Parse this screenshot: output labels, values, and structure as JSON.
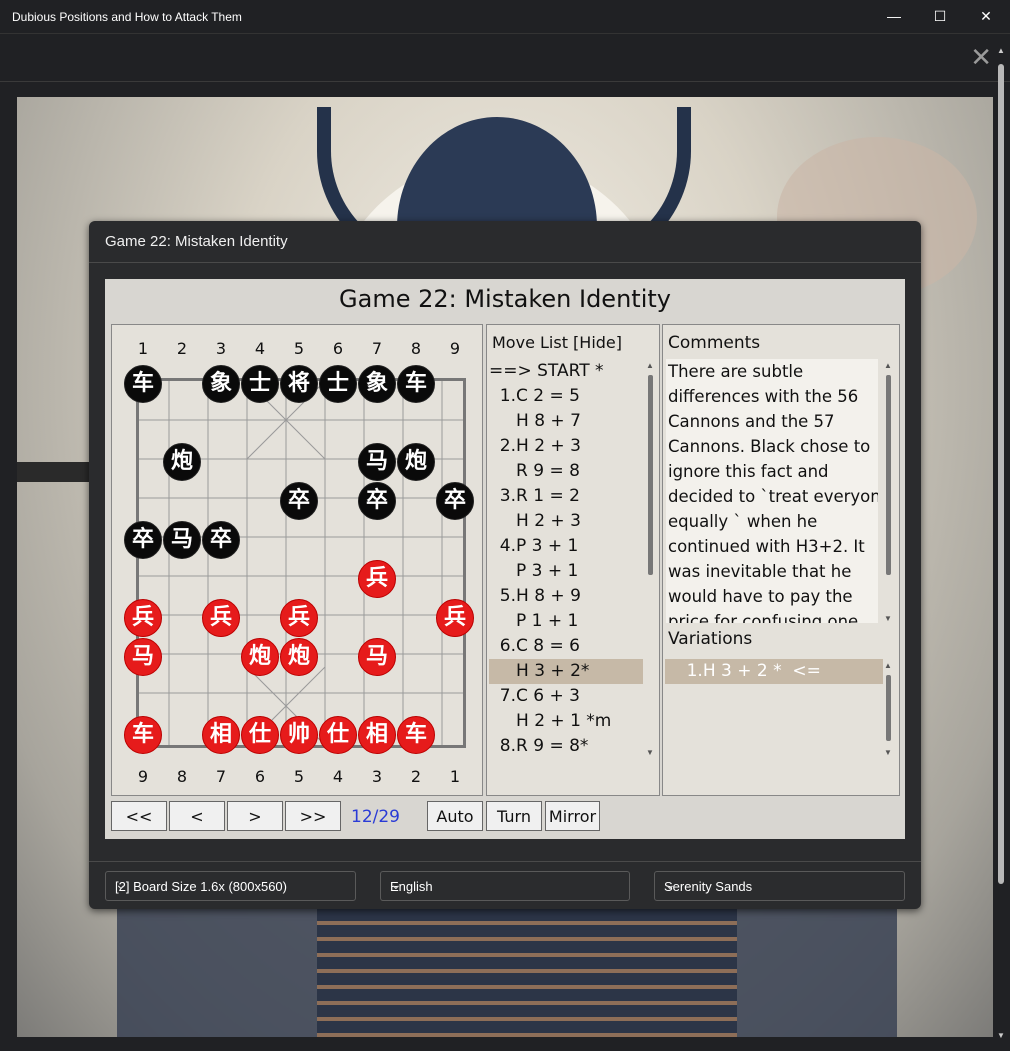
{
  "window": {
    "title": "Dubious Positions and How to Attack Them",
    "minimize": "—",
    "maximize": "☐",
    "close": "✕"
  },
  "toolbar": {
    "close_icon": "✕"
  },
  "dialog": {
    "title": "Game 22: Mistaken Identity",
    "game_title": "Game 22: Mistaken Identity"
  },
  "board": {
    "files_top": [
      "1",
      "2",
      "3",
      "4",
      "5",
      "6",
      "7",
      "8",
      "9"
    ],
    "files_bottom": [
      "9",
      "8",
      "7",
      "6",
      "5",
      "4",
      "3",
      "2",
      "1"
    ],
    "pieces": [
      {
        "char": "车",
        "side": "black",
        "file": 0,
        "rank": 0
      },
      {
        "char": "象",
        "side": "black",
        "file": 2,
        "rank": 0
      },
      {
        "char": "士",
        "side": "black",
        "file": 3,
        "rank": 0
      },
      {
        "char": "将",
        "side": "black",
        "file": 4,
        "rank": 0
      },
      {
        "char": "士",
        "side": "black",
        "file": 5,
        "rank": 0
      },
      {
        "char": "象",
        "side": "black",
        "file": 6,
        "rank": 0
      },
      {
        "char": "车",
        "side": "black",
        "file": 7,
        "rank": 0
      },
      {
        "char": "炮",
        "side": "black",
        "file": 1,
        "rank": 2
      },
      {
        "char": "马",
        "side": "black",
        "file": 6,
        "rank": 2
      },
      {
        "char": "炮",
        "side": "black",
        "file": 7,
        "rank": 2
      },
      {
        "char": "卒",
        "side": "black",
        "file": 4,
        "rank": 3
      },
      {
        "char": "卒",
        "side": "black",
        "file": 6,
        "rank": 3
      },
      {
        "char": "卒",
        "side": "black",
        "file": 8,
        "rank": 3
      },
      {
        "char": "卒",
        "side": "black",
        "file": 0,
        "rank": 4
      },
      {
        "char": "马",
        "side": "black",
        "file": 1,
        "rank": 4
      },
      {
        "char": "卒",
        "side": "black",
        "file": 2,
        "rank": 4
      },
      {
        "char": "兵",
        "side": "red",
        "file": 6,
        "rank": 5
      },
      {
        "char": "兵",
        "side": "red",
        "file": 0,
        "rank": 6
      },
      {
        "char": "兵",
        "side": "red",
        "file": 2,
        "rank": 6
      },
      {
        "char": "兵",
        "side": "red",
        "file": 4,
        "rank": 6
      },
      {
        "char": "兵",
        "side": "red",
        "file": 8,
        "rank": 6
      },
      {
        "char": "马",
        "side": "red",
        "file": 0,
        "rank": 7
      },
      {
        "char": "炮",
        "side": "red",
        "file": 3,
        "rank": 7
      },
      {
        "char": "炮",
        "side": "red",
        "file": 4,
        "rank": 7
      },
      {
        "char": "马",
        "side": "red",
        "file": 6,
        "rank": 7
      },
      {
        "char": "车",
        "side": "red",
        "file": 0,
        "rank": 9
      },
      {
        "char": "相",
        "side": "red",
        "file": 2,
        "rank": 9
      },
      {
        "char": "仕",
        "side": "red",
        "file": 3,
        "rank": 9
      },
      {
        "char": "帅",
        "side": "red",
        "file": 4,
        "rank": 9
      },
      {
        "char": "仕",
        "side": "red",
        "file": 5,
        "rank": 9
      },
      {
        "char": "相",
        "side": "red",
        "file": 6,
        "rank": 9
      },
      {
        "char": "车",
        "side": "red",
        "file": 7,
        "rank": 9
      }
    ]
  },
  "nav": {
    "first": "<<",
    "prev": "<",
    "next": ">",
    "last": ">>",
    "counter": "12/29",
    "auto": "Auto",
    "turn": "Turn",
    "mirror": "Mirror"
  },
  "moves": {
    "header": "Move List [Hide]",
    "rows": [
      "==> START *",
      "  1.C 2 = 5",
      "     H 8 + 7",
      "  2.H 2 + 3",
      "     R 9 = 8",
      "  3.R 1 = 2",
      "     H 2 + 3",
      "  4.P 3 + 1",
      "     P 3 + 1",
      "  5.H 8 + 9",
      "     P 1 + 1",
      "  6.C 8 = 6",
      "     H 3 + 2*",
      "  7.C 6 + 3",
      "     H 2 + 1 *m",
      "  8.R 9 = 8*"
    ],
    "selected_index": 12
  },
  "comments": {
    "header": "Comments",
    "lines": [
      "There are subtle",
      "differences with the 56",
      "Cannons and the 57",
      "Cannons. Black chose to",
      "ignore this fact and",
      "decided to `treat everyone",
      "equally ` when he",
      "continued with H3+2. It",
      "was inevitable that he",
      "would have to pay the",
      "price for confusing one"
    ]
  },
  "variations": {
    "header": "Variations",
    "rows": [
      "    1.H 3 + 2 *  <="
    ]
  },
  "footer": {
    "board_size": "[2] Board Size 1.6x (800x560)",
    "language": "English",
    "theme": "Serenity Sands"
  }
}
